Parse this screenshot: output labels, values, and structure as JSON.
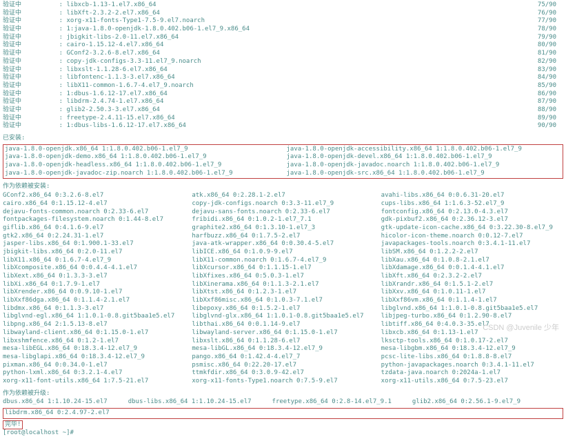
{
  "verify": {
    "label": "验证中",
    "rows": [
      {
        "pkg": "libxcb-1.13-1.el7.x86_64",
        "count": "75/90"
      },
      {
        "pkg": "libXft-2.3.2-2.el7.x86_64",
        "count": "76/90"
      },
      {
        "pkg": "xorg-x11-fonts-Type1-7.5-9.el7.noarch",
        "count": "77/90"
      },
      {
        "pkg": "1:java-1.8.0-openjdk-1.8.0.402.b06-1.el7_9.x86_64",
        "count": "78/90"
      },
      {
        "pkg": "jbigkit-libs-2.0-11.el7.x86_64",
        "count": "79/90"
      },
      {
        "pkg": "cairo-1.15.12-4.el7.x86_64",
        "count": "80/90"
      },
      {
        "pkg": "GConf2-3.2.6-8.el7.x86_64",
        "count": "81/90"
      },
      {
        "pkg": "copy-jdk-configs-3.3-11.el7_9.noarch",
        "count": "82/90"
      },
      {
        "pkg": "libxslt-1.1.28-6.el7.x86_64",
        "count": "83/90"
      },
      {
        "pkg": "libfontenc-1.1.3-3.el7.x86_64",
        "count": "84/90"
      },
      {
        "pkg": "libX11-common-1.6.7-4.el7_9.noarch",
        "count": "85/90"
      },
      {
        "pkg": "1:dbus-1.6.12-17.el7.x86_64",
        "count": "86/90"
      },
      {
        "pkg": "libdrm-2.4.74-1.el7.x86_64",
        "count": "87/90"
      },
      {
        "pkg": "glib2-2.50.3-3.el7.x86_64",
        "count": "88/90"
      },
      {
        "pkg": "freetype-2.4.11-15.el7.x86_64",
        "count": "89/90"
      },
      {
        "pkg": "1:dbus-libs-1.6.12-17.el7.x86_64",
        "count": "90/90"
      }
    ]
  },
  "installed": {
    "header": "已安装:",
    "items": [
      "java-1.8.0-openjdk.x86_64 1:1.8.0.402.b06-1.el7_9",
      "java-1.8.0-openjdk-accessibility.x86_64 1:1.8.0.402.b06-1.el7_9",
      "java-1.8.0-openjdk-demo.x86_64 1:1.8.0.402.b06-1.el7_9",
      "java-1.8.0-openjdk-devel.x86_64 1:1.8.0.402.b06-1.el7_9",
      "java-1.8.0-openjdk-headless.x86_64 1:1.8.0.402.b06-1.el7_9",
      "java-1.8.0-openjdk-javadoc.noarch 1:1.8.0.402.b06-1.el7_9",
      "java-1.8.0-openjdk-javadoc-zip.noarch 1:1.8.0.402.b06-1.el7_9",
      "java-1.8.0-openjdk-src.x86_64 1:1.8.0.402.b06-1.el7_9"
    ]
  },
  "deps": {
    "header": "作为依赖被安装:",
    "items": [
      "GConf2.x86_64 0:3.2.6-8.el7",
      "atk.x86_64 0:2.28.1-2.el7",
      "avahi-libs.x86_64 0:0.6.31-20.el7",
      "cairo.x86_64 0:1.15.12-4.el7",
      "copy-jdk-configs.noarch 0:3.3-11.el7_9",
      "cups-libs.x86_64 1:1.6.3-52.el7_9",
      "dejavu-fonts-common.noarch 0:2.33-6.el7",
      "dejavu-sans-fonts.noarch 0:2.33-6.el7",
      "fontconfig.x86_64 0:2.13.0-4.3.el7",
      "fontpackages-filesystem.noarch 0:1.44-8.el7",
      "fribidi.x86_64 0:1.0.2-1.el7_7.1",
      "gdk-pixbuf2.x86_64 0:2.36.12-3.el7",
      "giflib.x86_64 0:4.1.6-9.el7",
      "graphite2.x86_64 0:1.3.10-1.el7_3",
      "gtk-update-icon-cache.x86_64 0:3.22.30-8.el7_9",
      "gtk2.x86_64 0:2.24.31-1.el7",
      "harfbuzz.x86_64 0:1.7.5-2.el7",
      "hicolor-icon-theme.noarch 0:0.12-7.el7",
      "jasper-libs.x86_64 0:1.900.1-33.el7",
      "java-atk-wrapper.x86_64 0:0.30.4-5.el7",
      "javapackages-tools.noarch 0:3.4.1-11.el7",
      "jbigkit-libs.x86_64 0:2.0-11.el7",
      "libICE.x86_64 0:1.0.9-9.el7",
      "libSM.x86_64 0:1.2.2-2.el7",
      "libX11.x86_64 0:1.6.7-4.el7_9",
      "libX11-common.noarch 0:1.6.7-4.el7_9",
      "libXau.x86_64 0:1.0.8-2.1.el7",
      "libXcomposite.x86_64 0:0.4.4-4.1.el7",
      "libXcursor.x86_64 0:1.1.15-1.el7",
      "libXdamage.x86_64 0:0.1.4-4.1.el7",
      "libXext.x86_64 0:1.3.3-3.el7",
      "libXfixes.x86_64 0:5.0.3-1.el7",
      "libXft.x86_64 0:2.3.2-2.el7",
      "libXi.x86_64 0:1.7.9-1.el7",
      "libXinerama.x86_64 0:1.1.3-2.1.el7",
      "libXrandr.x86_64 0:1.5.1-2.el7",
      "libXrender.x86_64 0:0.9.10-1.el7",
      "libXtst.x86_64 0:1.2.3-1.el7",
      "libXxv.x86_64 0:1.0.11-1.el7",
      "libXxf86dga.x86_64 0:1.1.4-2.1.el7",
      "libXxf86misc.x86_64 0:1.0.3-7.1.el7",
      "libXxf86vm.x86_64 0:1.1.4-1.el7",
      "libdmx.x86_64 0:1.1.3-3.el7",
      "libepoxy.x86_64 0:1.5.2-1.el7",
      "libglvnd.x86_64 1:1.0.1-0.8.git5baa1e5.el7",
      "libglvnd-egl.x86_64 1:1.0.1-0.8.git5baa1e5.el7",
      "libglvnd-glx.x86_64 1:1.0.1-0.8.git5baa1e5.el7",
      "libjpeg-turbo.x86_64 0:1.2.90-8.el7",
      "libpng.x86_64 2:1.5.13-8.el7",
      "libthai.x86_64 0:0.1.14-9.el7",
      "libtiff.x86_64 0:4.0.3-35.el7",
      "libwayland-client.x86_64 0:1.15.0-1.el7",
      "libwayland-server.x86_64 0:1.15.0-1.el7",
      "libxcb.x86_64 0:1.13-1.el7",
      "libxshmfence.x86_64 0:1.2-1.el7",
      "libxslt.x86_64 0:1.1.28-6.el7",
      "lksctp-tools.x86_64 0:1.0.17-2.el7",
      "mesa-libEGL.x86_64 0:18.3.4-12.el7_9",
      "mesa-libGL.x86_64 0:18.3.4-12.el7_9",
      "mesa-libgbm.x86_64 0:18.3.4-12.el7_9",
      "mesa-libglapi.x86_64 0:18.3.4-12.el7_9",
      "pango.x86_64 0:1.42.4-4.el7_7",
      "pcsc-lite-libs.x86_64 0:1.8.8-8.el7",
      "pixman.x86_64 0:0.34.0-1.el7",
      "psmisc.x86_64 0:22.20-17.el7",
      "python-javapackages.noarch 0:3.4.1-11.el7",
      "python-lxml.x86_64 0:3.2.1-4.el7",
      "ttmkfdir.x86_64 0:3.0.9-42.el7",
      "tzdata-java.noarch 0:2024a-1.el7",
      "xorg-x11-font-utils.x86_64 1:7.5-21.el7",
      "xorg-x11-fonts-Type1.noarch 0:7.5-9.el7",
      "xorg-x11-utils.x86_64 0:7.5-23.el7"
    ]
  },
  "upgraded": {
    "header": "作为依赖被升级:",
    "line1": [
      "dbus.x86_64 1:1.10.24-15.el7",
      "dbus-libs.x86_64 1:1.10.24-15.el7",
      "freetype.x86_64 0:2.8-14.el7_9.1",
      "glib2.x86_64 0:2.56.1-9.el7_9"
    ],
    "line2": "libdrm.x86_64 0:2.4.97-2.el7"
  },
  "complete": "完毕!",
  "prompt": "[root@localhost ~]#",
  "watermark": "CSDN @Juvenile 少年"
}
